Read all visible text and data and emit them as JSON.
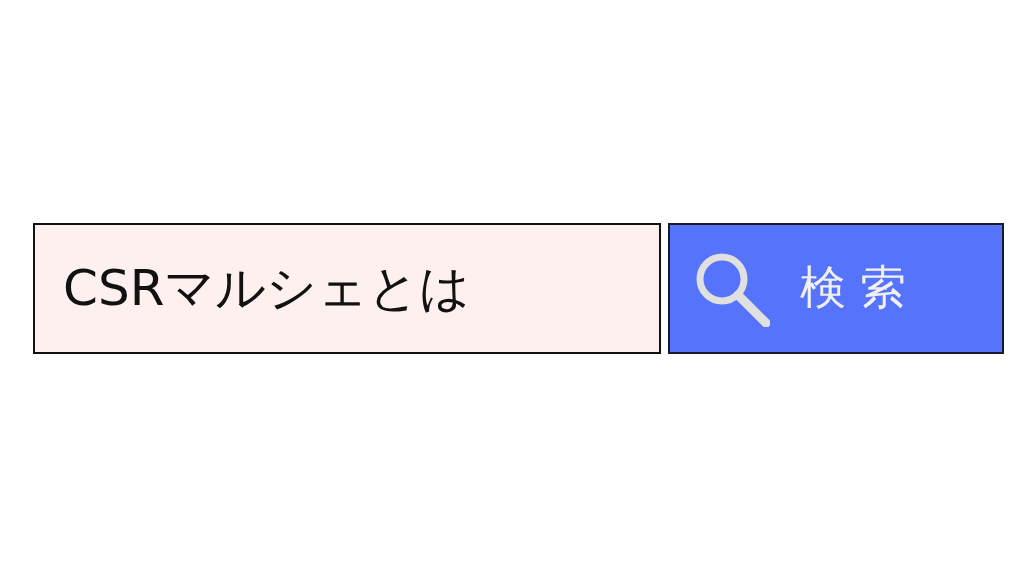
{
  "search": {
    "value": "CSRマルシェとは"
  },
  "button": {
    "label": "検索"
  }
}
